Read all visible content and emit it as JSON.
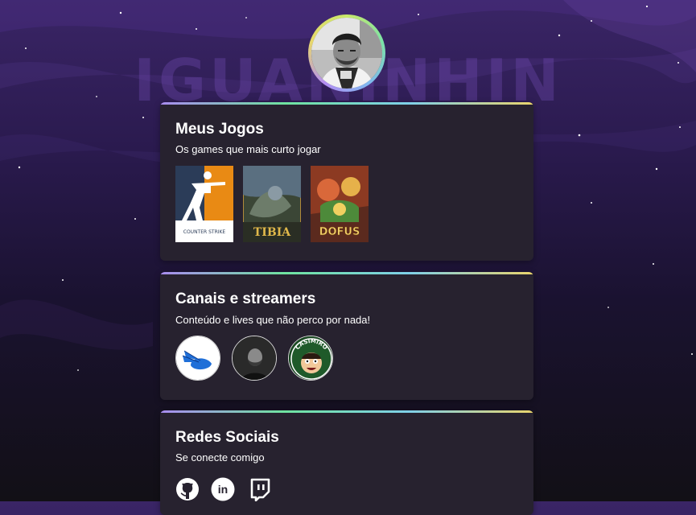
{
  "background": {
    "name_text": "IGUANINHIN",
    "colors": {
      "top": "#3a2566",
      "bottom": "#121016"
    }
  },
  "profile": {
    "avatar_icon": "profile-photo"
  },
  "games_card": {
    "title": "Meus Jogos",
    "subtitle": "Os games que mais curto jogar",
    "games": [
      {
        "name": "counter-strike",
        "cover_text": "COUNTER STRIKE"
      },
      {
        "name": "tibia",
        "cover_text": "TIBIA"
      },
      {
        "name": "dofus",
        "cover_text": "DOFUS"
      }
    ]
  },
  "streamers_card": {
    "title": "Canais e streamers",
    "subtitle": "Conteúdo e lives que não perco por nada!",
    "channels": [
      {
        "name": "winged-helmet-channel"
      },
      {
        "name": "bearded-streamer-channel"
      },
      {
        "name": "casimiro",
        "ring_text": "CASIMIRO"
      }
    ]
  },
  "social_card": {
    "title": "Redes Sociais",
    "subtitle": "Se conecte comigo",
    "links": [
      {
        "icon": "github-icon"
      },
      {
        "icon": "linkedin-icon",
        "label": "in"
      },
      {
        "icon": "twitch-icon"
      }
    ]
  },
  "accent_gradient": [
    "#a98cf0",
    "#6fe3a0",
    "#7fd0e8",
    "#e9d46c"
  ],
  "card_color": "#27222f"
}
